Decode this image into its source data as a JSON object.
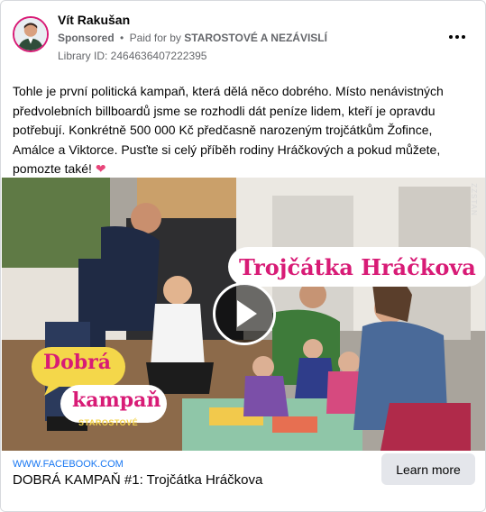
{
  "post": {
    "page_name": "Vít Rakušan",
    "sponsored_label": "Sponsored",
    "separator": "•",
    "paid_for_prefix": "Paid for by",
    "paid_for_name": "STAROSTOVÉ A NEZÁVISLÍ",
    "library_id": "Library ID: 2464636407222395",
    "text": "Tohle je první politická kampaň, která dělá něco dobrého. Místo nenávistných předvolebních billboardů jsme se rozhodli dát peníze lidem, kteří je opravdu potřebují. Konkrétně 500 000 Kč předčasně narozeným trojčátkům Žofince, Amálce a Viktorce. Pusťte si celý příběh rodiny Hráčkových a pokud můžete, pomozte také!",
    "emoji": "❤"
  },
  "media": {
    "title_overlay": "Trojčátka Hráčkova",
    "badge_line1": "Dobrá",
    "badge_line2": "kampaň",
    "badge_brand": "STAROSTOVÉ",
    "watermark": "ZZSTAN",
    "play_icon": "play-icon"
  },
  "link": {
    "domain": "WWW.FACEBOOK.COM",
    "headline": "DOBRÁ KAMPAŇ #1: Trojčátka Hráčkova",
    "cta_label": "Learn more"
  },
  "colors": {
    "brand_pink": "#d81b76",
    "link_blue": "#1877f2",
    "secondary_text": "#65676b",
    "cta_bg": "#e4e6eb"
  }
}
